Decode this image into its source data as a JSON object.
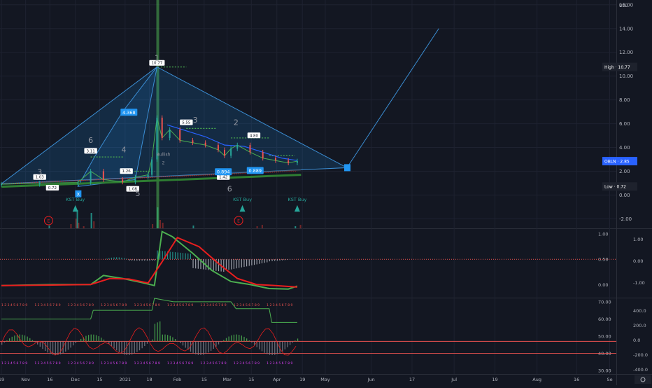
{
  "chart_data": [
    {
      "type": "candlestick",
      "symbol": "OBLN",
      "currency": "USD",
      "y_ticks": [
        "16.00",
        "14.00",
        "12.00",
        "10.00",
        "8.00",
        "6.00",
        "4.00",
        "2.00",
        "0.00",
        "-2.00"
      ],
      "y_tick_values": [
        16,
        14,
        12,
        10,
        8,
        6,
        4,
        2,
        0,
        -2
      ],
      "ylim": [
        -2.8,
        16.4
      ],
      "x_tick_labels": [
        "19",
        "Nov",
        "16",
        "Dec",
        "15",
        "2021",
        "18",
        "Feb",
        "15",
        "Mar",
        "15",
        "Apr",
        "19",
        "May",
        "Jun",
        "17",
        "Jul",
        "19",
        "Aug",
        "16",
        "Se"
      ],
      "x_tick_index": [
        0,
        19,
        38,
        58,
        77,
        97,
        116,
        138,
        159,
        177,
        196,
        216,
        236,
        254,
        290,
        322,
        355,
        387,
        420,
        451,
        477
      ],
      "price_labels": [
        {
          "label": "High",
          "value": "10.77",
          "color": "#1e222d"
        },
        {
          "label": "OBLN",
          "value": "2.85",
          "color": "#2962ff"
        },
        {
          "label": "Low",
          "value": "0.72",
          "color": "#1e222d"
        }
      ],
      "closes": [
        {
          "index": 0,
          "close": 0.9
        },
        {
          "index": 30,
          "close": 1.0
        },
        {
          "index": 60,
          "close": 1.05
        },
        {
          "index": 70,
          "close": 2.0
        },
        {
          "index": 80,
          "close": 1.3
        },
        {
          "index": 95,
          "close": 1.1
        },
        {
          "index": 105,
          "close": 1.5
        },
        {
          "index": 115,
          "close": 1.7
        },
        {
          "index": 118,
          "close": 3.0
        },
        {
          "index": 122,
          "close": 6.5
        },
        {
          "index": 126,
          "close": 4.8
        },
        {
          "index": 132,
          "close": 5.5
        },
        {
          "index": 140,
          "close": 4.6
        },
        {
          "index": 150,
          "close": 4.4
        },
        {
          "index": 160,
          "close": 4.2
        },
        {
          "index": 170,
          "close": 3.8
        },
        {
          "index": 175,
          "close": 3.3
        },
        {
          "index": 180,
          "close": 3.9
        },
        {
          "index": 185,
          "close": 4.2
        },
        {
          "index": 195,
          "close": 3.6
        },
        {
          "index": 205,
          "close": 3.1
        },
        {
          "index": 215,
          "close": 2.9
        },
        {
          "index": 225,
          "close": 2.7
        },
        {
          "index": 232,
          "close": 2.85
        }
      ],
      "pattern_points": [
        {
          "label": "X",
          "index": 60,
          "price": 0.72
        },
        {
          "label": "",
          "index": 122,
          "price": 10.77
        },
        {
          "label": "",
          "index": 105,
          "price": 1.3
        },
        {
          "label": "",
          "index": 271,
          "price": 2.3
        },
        {
          "label": "",
          "index": 343,
          "price": 14.0
        }
      ],
      "ratio_labels": [
        "4.368",
        "0.894",
        "0.889"
      ],
      "swing_labels": [
        "1.03",
        "0.72",
        "3.11",
        "1.26",
        "1.08",
        "10.77",
        "5.55",
        "1.42",
        "4.80"
      ],
      "wave_labels": [
        "3",
        "6",
        "4",
        "5",
        "1",
        "3",
        "2",
        "6",
        "Bullish",
        "2"
      ],
      "signals": [
        "KST Buy",
        "KST Buy",
        "KST Buy"
      ],
      "earnings_marker": "E"
    },
    {
      "type": "line",
      "name": "oscillator-1",
      "y_ticks_left": [
        "1.00",
        "0.50",
        "0.00"
      ],
      "y_tick_values_left": [
        1.0,
        0.5,
        0.0
      ],
      "y_ticks_right": [
        "1.00",
        "0.00",
        "-1.00"
      ],
      "ylim": [
        -0.26,
        1.1
      ],
      "series": [
        {
          "name": "",
          "color": "#4caf50",
          "points": [
            [
              0,
              -0.02
            ],
            [
              40,
              0.0
            ],
            [
              70,
              0.0
            ],
            [
              80,
              0.18
            ],
            [
              95,
              0.12
            ],
            [
              110,
              0.04
            ],
            [
              120,
              -0.02
            ],
            [
              126,
              1.05
            ],
            [
              134,
              0.95
            ],
            [
              150,
              0.62
            ],
            [
              165,
              0.28
            ],
            [
              180,
              0.06
            ],
            [
              195,
              0.0
            ],
            [
              210,
              -0.08
            ],
            [
              225,
              -0.09
            ],
            [
              232,
              -0.03
            ]
          ]
        },
        {
          "name": "",
          "color": "#e91e1e",
          "points": [
            [
              0,
              -0.02
            ],
            [
              40,
              -0.01
            ],
            [
              70,
              0.0
            ],
            [
              85,
              0.12
            ],
            [
              100,
              0.11
            ],
            [
              115,
              0.03
            ],
            [
              126,
              0.45
            ],
            [
              138,
              0.93
            ],
            [
              155,
              0.75
            ],
            [
              170,
              0.42
            ],
            [
              185,
              0.12
            ],
            [
              200,
              0.0
            ],
            [
              215,
              -0.02
            ],
            [
              232,
              -0.05
            ]
          ]
        }
      ]
    },
    {
      "type": "line",
      "name": "oscillator-2",
      "y_ticks_left": [
        "70.00",
        "60.00",
        "50.00",
        "40.00",
        "30.00"
      ],
      "y_tick_values_left": [
        70,
        60,
        50,
        40,
        30
      ],
      "y_ticks_right": [
        "400.0",
        "200.0",
        "0.0",
        "-200.0",
        "-400.0"
      ],
      "ylim": [
        28,
        72
      ],
      "numbers_row": "1 2 3 4 5 6 7 8 9"
    }
  ]
}
